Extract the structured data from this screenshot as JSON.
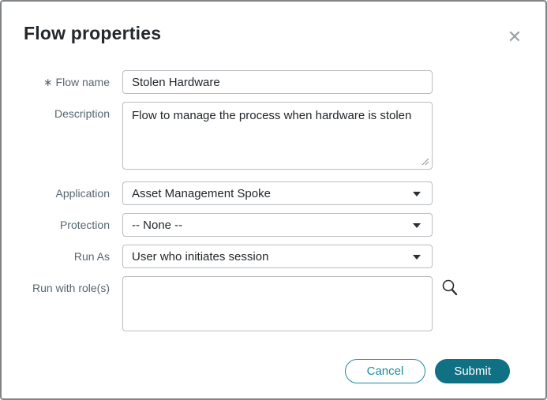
{
  "dialog": {
    "title": "Flow properties"
  },
  "icons": {
    "close": "✕",
    "required_marker": "∗",
    "search": "magnifier",
    "caret": "triangle-down",
    "resize": "diagonal-grip"
  },
  "fields": {
    "flow_name": {
      "label": "Flow name",
      "required": true,
      "value": "Stolen Hardware"
    },
    "description": {
      "label": "Description",
      "required": false,
      "value": "Flow to manage the process when hardware is stolen"
    },
    "application": {
      "label": "Application",
      "required": false,
      "value": "Asset Management Spoke"
    },
    "protection": {
      "label": "Protection",
      "required": false,
      "value": "-- None --"
    },
    "run_as": {
      "label": "Run As",
      "required": false,
      "value": "User who initiates session"
    },
    "run_with_roles": {
      "label": "Run with role(s)",
      "required": false,
      "value": ""
    }
  },
  "footer": {
    "cancel_label": "Cancel",
    "submit_label": "Submit"
  },
  "colors": {
    "accent_teal": "#1e8aa0",
    "submit_fill": "#107184",
    "dialog_border": "#818487",
    "field_border": "#b8bdc1",
    "label_text": "#57666f",
    "title_text": "#23282c"
  }
}
